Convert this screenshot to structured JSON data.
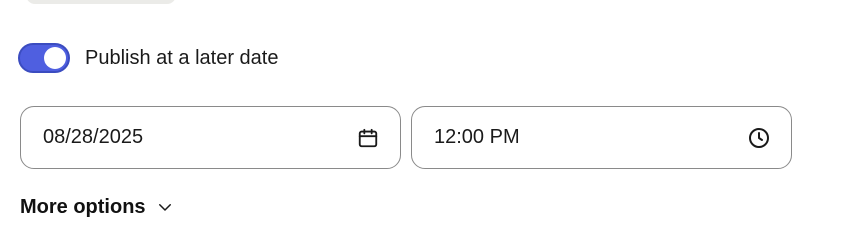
{
  "schedule": {
    "toggle_label": "Publish at a later date",
    "toggle_on": true,
    "date_value": "08/28/2025",
    "time_value": "12:00 PM"
  },
  "more_options": {
    "label": "More options"
  },
  "colors": {
    "accent": "#4f5fe0",
    "border": "#8a8a8a"
  },
  "icons": {
    "date": "calendar-icon",
    "time": "clock-icon",
    "more": "chevron-down-icon"
  }
}
